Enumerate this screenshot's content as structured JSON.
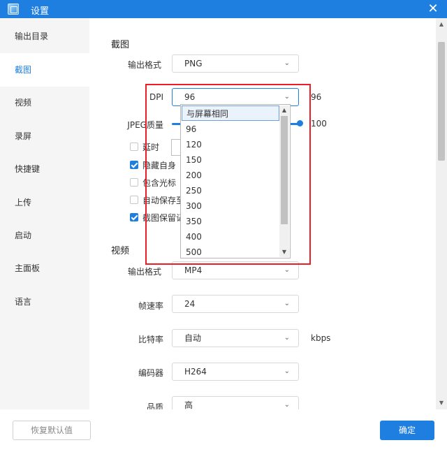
{
  "window": {
    "title": "设置"
  },
  "sidebar": {
    "items": [
      {
        "label": "输出目录"
      },
      {
        "label": "截图",
        "active": true
      },
      {
        "label": "视频"
      },
      {
        "label": "录屏"
      },
      {
        "label": "快捷键"
      },
      {
        "label": "上传"
      },
      {
        "label": "启动"
      },
      {
        "label": "主面板"
      },
      {
        "label": "语言"
      }
    ]
  },
  "screenshot": {
    "section_title": "截图",
    "output_format": {
      "label": "输出格式",
      "value": "PNG"
    },
    "dpi": {
      "label": "DPI",
      "value": "96",
      "value_display": "96",
      "options": [
        "与屏幕相同",
        "96",
        "120",
        "150",
        "200",
        "250",
        "300",
        "350",
        "400",
        "500"
      ],
      "highlighted_option": "与屏幕相同"
    },
    "jpeg_quality": {
      "label": "JPEG质量",
      "value_label": "100",
      "level": 1.0
    },
    "checkboxes": [
      {
        "label": "延时",
        "checked": false
      },
      {
        "label": "隐藏自身",
        "checked": true
      },
      {
        "label": "包含光标",
        "checked": false
      },
      {
        "label": "自动保存至",
        "checked": false
      },
      {
        "label": "截图保留记",
        "checked": true
      }
    ]
  },
  "video": {
    "section_title": "视频",
    "output_format": {
      "label": "输出格式",
      "value": "MP4"
    },
    "frame_rate": {
      "label": "帧速率",
      "value": "24"
    },
    "bitrate": {
      "label": "比特率",
      "value": "自动",
      "unit": "kbps"
    },
    "encoder": {
      "label": "编码器",
      "value": "H264"
    },
    "quality": {
      "label": "品质",
      "value": "高"
    }
  },
  "footer": {
    "reset_label": "恢复默认值",
    "ok_label": "确定"
  },
  "colors": {
    "accent": "#1f7fe0",
    "highlight_box": "#ee1c24"
  }
}
